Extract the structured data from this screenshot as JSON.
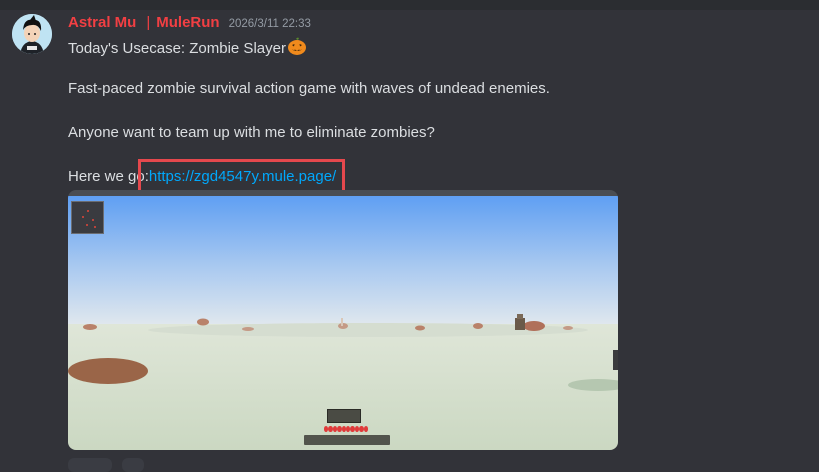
{
  "message": {
    "author": "Astral Mu",
    "separator": "|",
    "server": "MuleRun",
    "timestamp": "2026/3/11 22:33",
    "lines": {
      "title": "Today's Usecase: Zombie Slayer",
      "title_emoji": "jack-o-lantern-icon",
      "description": "Fast-paced zombie survival action game with waves of undead enemies.",
      "invite": "Anyone want to team up with me to eliminate zombies?",
      "link_prefix": "Here we go:",
      "link_url": "https://zgd4547y.mule.page/"
    }
  },
  "colors": {
    "background": "#323339",
    "author": "#f23f43",
    "link": "#00a8fc",
    "highlight_box": "#e5484d",
    "text": "#dbdee1",
    "timestamp": "#949ba4"
  },
  "embed": {
    "type": "game-screenshot",
    "hud_hearts": 10
  }
}
